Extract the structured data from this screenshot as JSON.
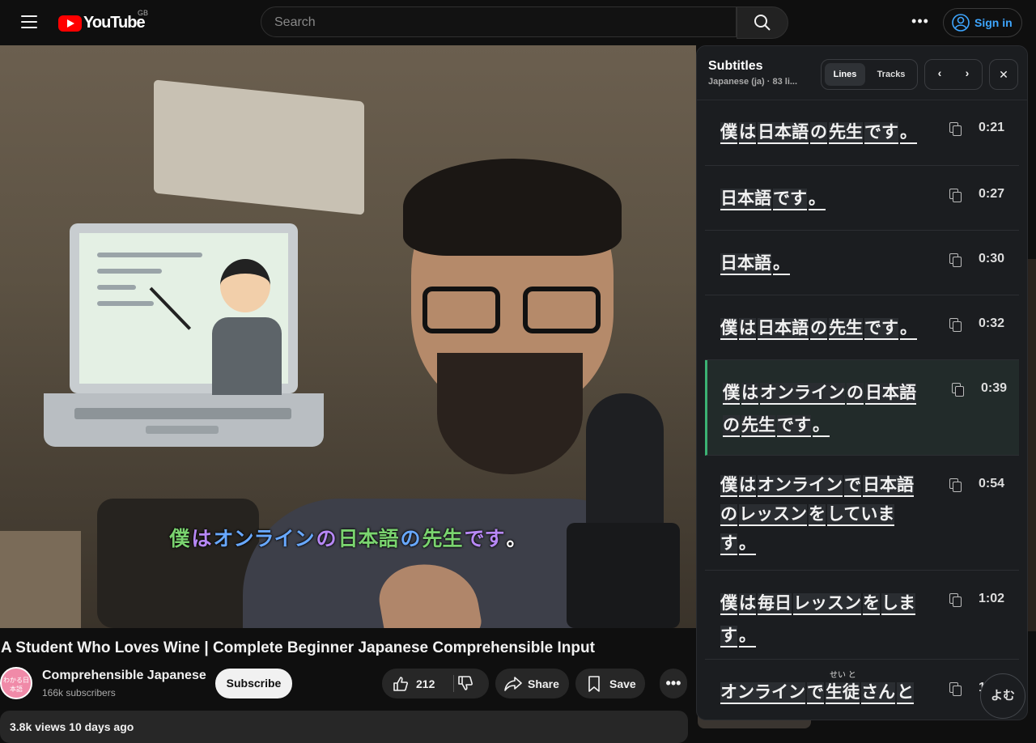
{
  "header": {
    "logo_text": "YouTube",
    "country_code": "GB",
    "search_placeholder": "Search",
    "signin_label": "Sign in",
    "more_label": "•••"
  },
  "video": {
    "caption_words": [
      "僕",
      "は",
      "オンライン",
      "の",
      "日本語",
      "の",
      "先生",
      "です",
      "。"
    ]
  },
  "meta": {
    "title": "A Student Who Loves Wine | Complete Beginner Japanese Comprehensible Input",
    "channel_name": "Comprehensible Japanese",
    "subscribers": "166k subscribers",
    "avatar_text": "わかる日本語",
    "subscribe_label": "Subscribe",
    "like_count": "212",
    "share_label": "Share",
    "save_label": "Save",
    "views_partial": "3.8k views  10 days ago"
  },
  "subtitles_panel": {
    "title": "Subtitles",
    "subtitle": "Japanese (ja) · 83 li...",
    "tab_lines": "Lines",
    "tab_tracks": "Tracks",
    "yomu_label": "よむ",
    "cues": [
      {
        "time": "0:21",
        "segments": [
          [
            "僕",
            "r"
          ],
          [
            "は",
            "r"
          ],
          [
            "日本語",
            "b"
          ],
          [
            "の",
            "b"
          ],
          [
            "先生",
            "o"
          ],
          [
            "です",
            "r"
          ],
          [
            "。",
            "n"
          ]
        ]
      },
      {
        "time": "0:27",
        "segments": [
          [
            "日本語",
            "b"
          ],
          [
            "です",
            "r"
          ],
          [
            "。",
            "n"
          ]
        ]
      },
      {
        "time": "0:30",
        "segments": [
          [
            "日本語",
            "b"
          ],
          [
            "。",
            "n"
          ]
        ]
      },
      {
        "time": "0:32",
        "segments": [
          [
            "僕",
            "r"
          ],
          [
            "は",
            "r"
          ],
          [
            "日本語",
            "b"
          ],
          [
            "の",
            "b"
          ],
          [
            "先生",
            "o"
          ],
          [
            "です",
            "r"
          ],
          [
            "。",
            "n"
          ]
        ]
      },
      {
        "time": "0:39",
        "segments": [
          [
            "僕",
            "r"
          ],
          [
            "は",
            "r"
          ],
          [
            "オンライン",
            "b"
          ],
          [
            "の",
            "b"
          ],
          [
            "日本語",
            "b"
          ],
          [
            "の",
            "b"
          ],
          [
            "先生",
            "o"
          ],
          [
            "です",
            "r"
          ],
          [
            "。",
            "n"
          ]
        ]
      },
      {
        "time": "0:54",
        "segments": [
          [
            "僕",
            "r"
          ],
          [
            "は",
            "r"
          ],
          [
            "オンライン",
            "b"
          ],
          [
            "で",
            "b"
          ],
          [
            "日本語",
            "b"
          ],
          [
            "の",
            "b"
          ],
          [
            "レッスン",
            "r"
          ],
          [
            "を",
            "r"
          ],
          [
            "していま",
            "b"
          ],
          [
            "す",
            "b"
          ],
          [
            "。",
            "n"
          ]
        ]
      },
      {
        "time": "1:02",
        "segments": [
          [
            "僕",
            "r"
          ],
          [
            "は",
            "r"
          ],
          [
            "毎日",
            "r"
          ],
          [
            "レッスン",
            "r"
          ],
          [
            "を",
            "r"
          ],
          [
            "しま",
            "b"
          ],
          [
            "す",
            "b"
          ],
          [
            "。",
            "n"
          ]
        ]
      },
      {
        "time": "1:10",
        "segments": [
          [
            "オンライン",
            "o"
          ],
          [
            "で",
            "o"
          ],
          [
            "生徒",
            "g"
          ],
          [
            "さん",
            "r"
          ],
          [
            "と",
            "r"
          ]
        ]
      }
    ],
    "last_cue_furigana": "せい と"
  }
}
